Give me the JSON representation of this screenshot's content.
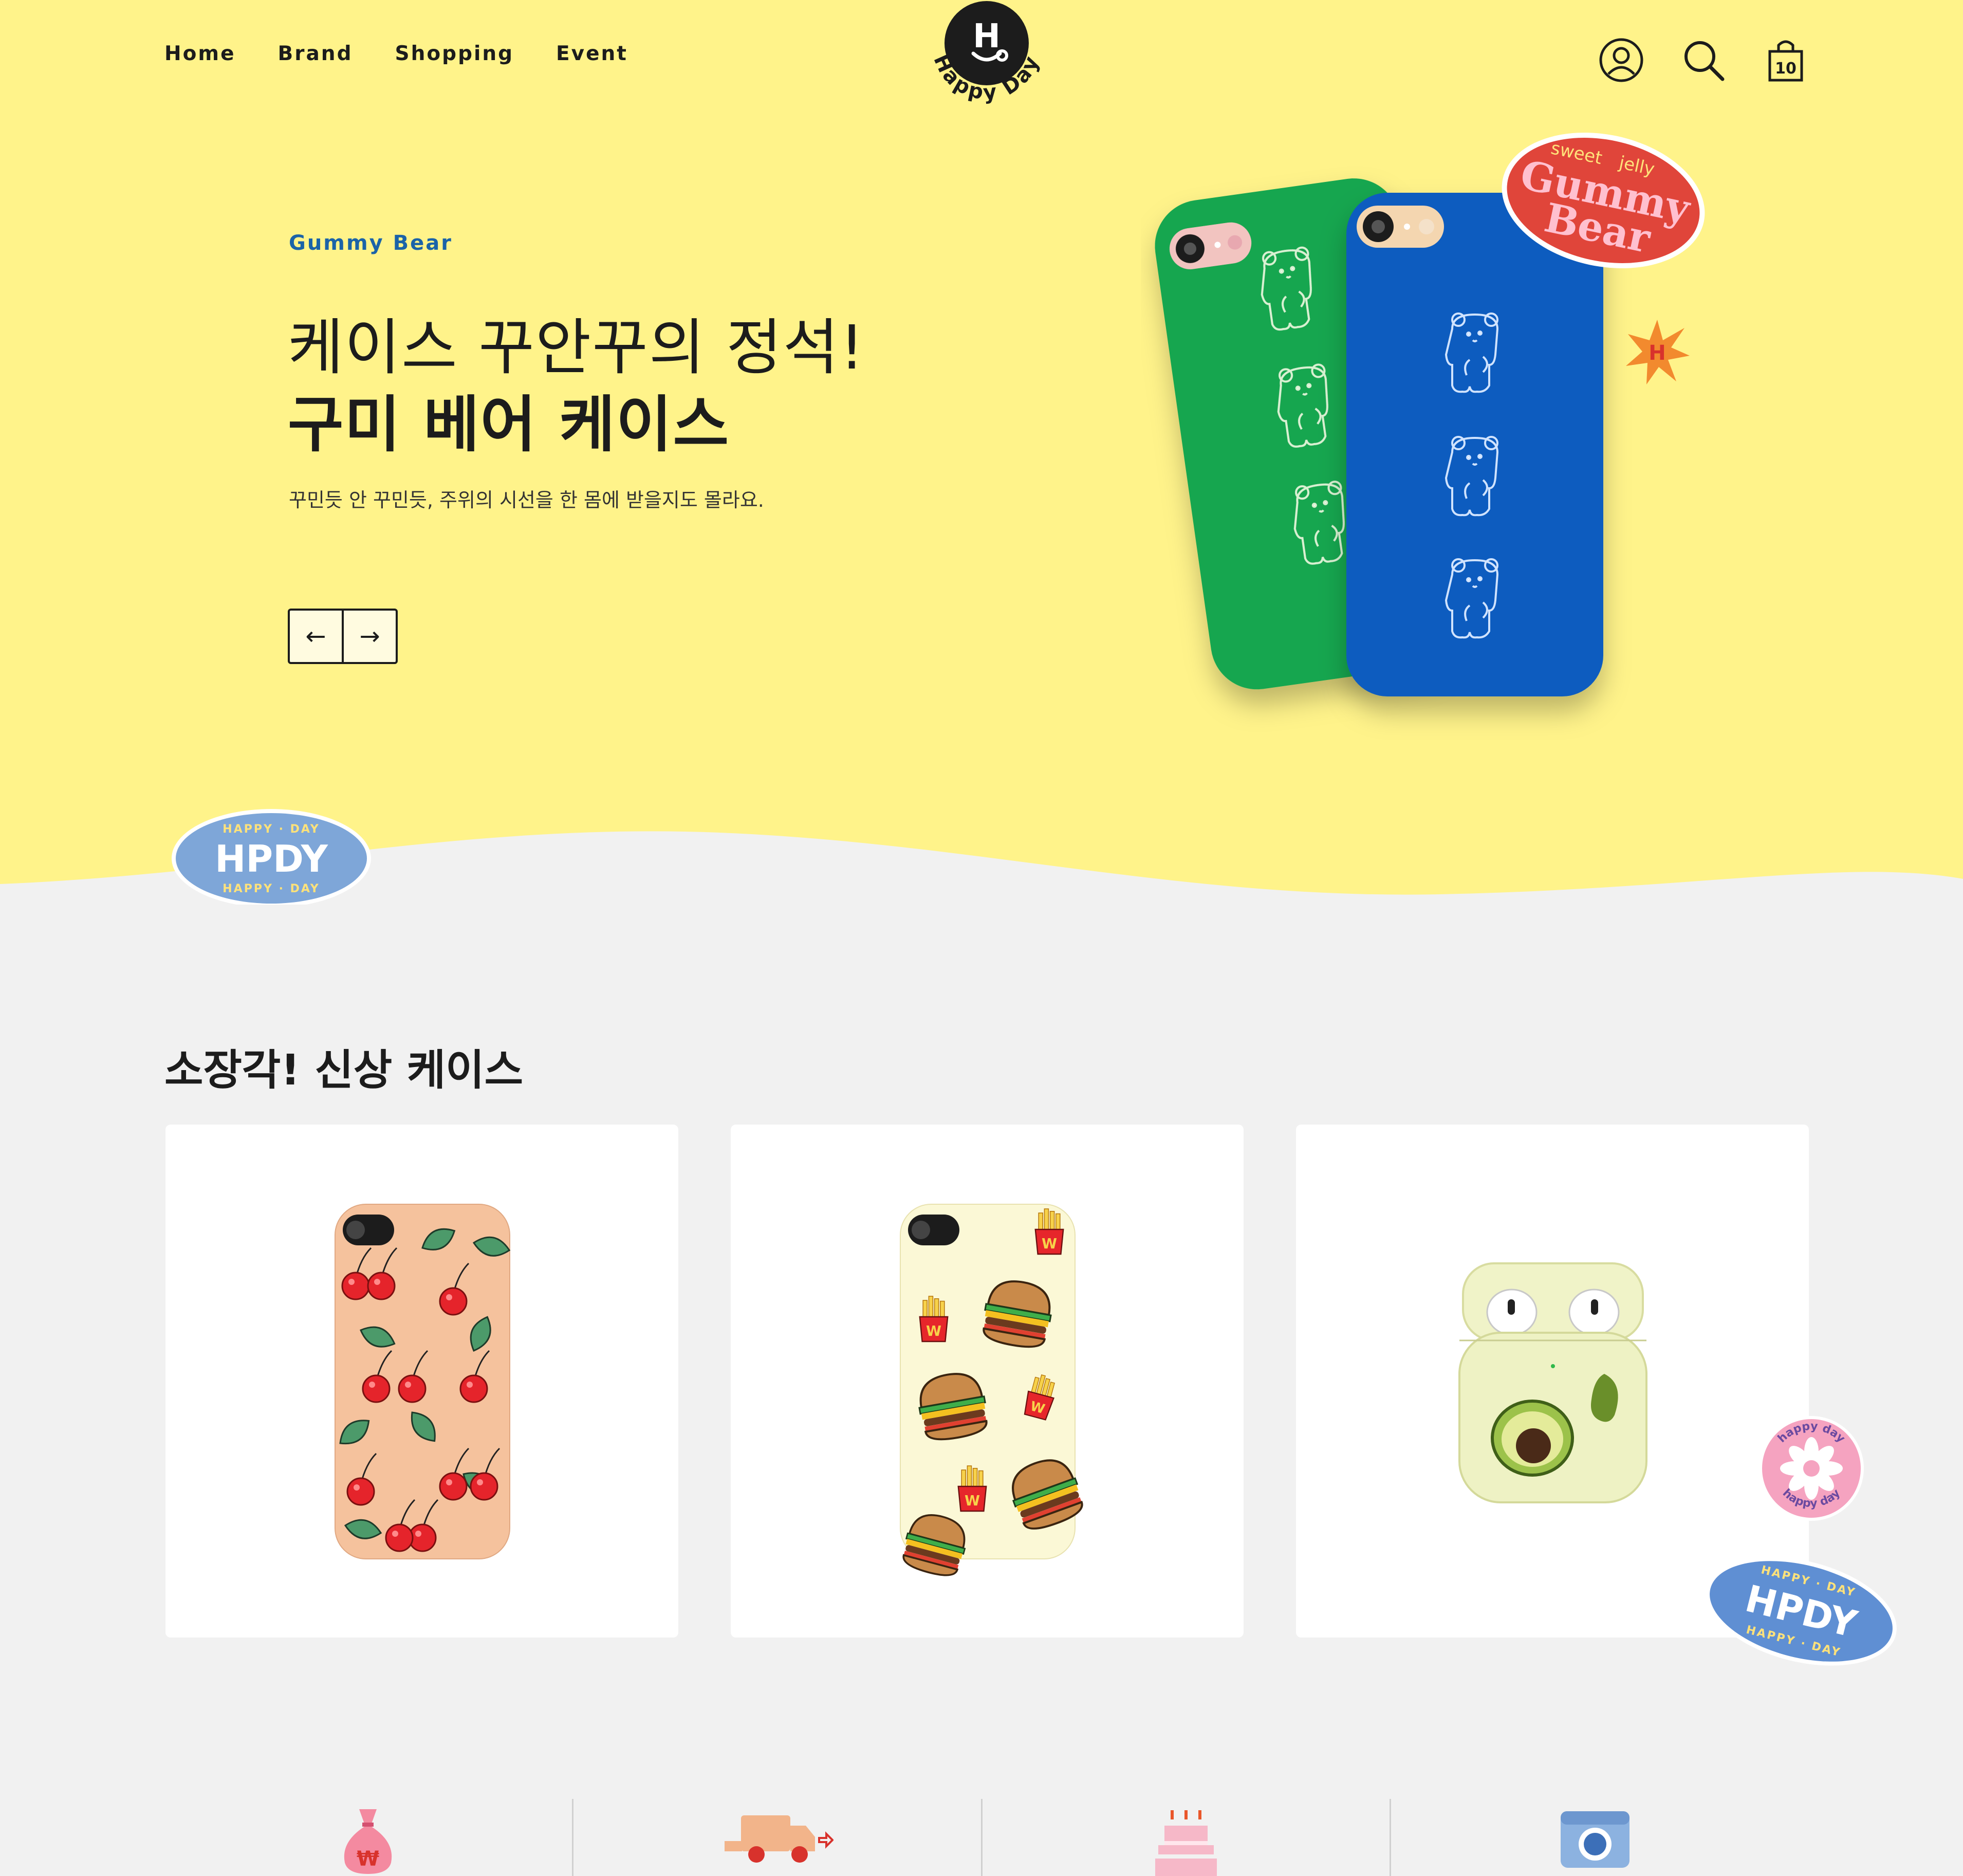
{
  "nav": {
    "items": [
      "Home",
      "Brand",
      "Shopping",
      "Event"
    ]
  },
  "logo": {
    "mark": "H",
    "text": "Happy Day"
  },
  "header_icons": [
    "user-icon",
    "search-icon",
    "bag-icon"
  ],
  "cart": {
    "count": "10"
  },
  "hero": {
    "subtitle": "Gummy Bear",
    "title_line1": "케이스 꾸안꾸의 정석!",
    "title_line2": "구미 베어 케이스",
    "description": "꾸민듯 안 꾸민듯, 주위의 시선을 한 몸에 받을지도 몰라요.",
    "prev_label": "←",
    "next_label": "→"
  },
  "stickers": {
    "gummy_top": "sweet",
    "gummy_top2": "jelly",
    "gummy_line1": "Gummy",
    "gummy_line2": "Bear",
    "burst": "H",
    "hpdy": "HPDY",
    "hpdy_ring": "HAPPY · DAY",
    "daisy_ring": "happy day"
  },
  "section": {
    "title": "소장각! 신상 케이스"
  },
  "products": [
    {
      "name": "cherry-phone-case"
    },
    {
      "name": "burger-phone-case"
    },
    {
      "name": "avocado-airpods-case"
    }
  ],
  "features": [
    {
      "icon": "money-bag-icon",
      "mark": "₩"
    },
    {
      "icon": "delivery-truck-icon"
    },
    {
      "icon": "birthday-cake-icon"
    },
    {
      "icon": "camera-icon"
    }
  ],
  "colors": {
    "hero_bg": "#fff38a",
    "page_bg": "#f1f1f1",
    "accent_blue": "#1b63a8",
    "case_green": "#12a650",
    "case_blue": "#0a5cbf",
    "sticker_red": "#e0453a",
    "sticker_blue": "#7ea6d8"
  }
}
